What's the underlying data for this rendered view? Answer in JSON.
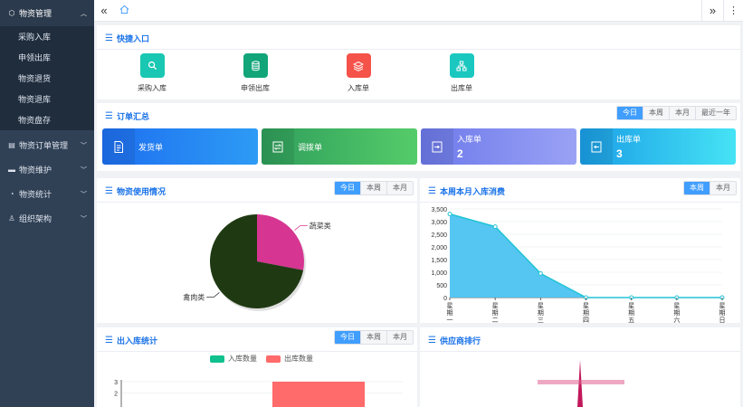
{
  "sidebar": {
    "active_group": {
      "label": "物资管理",
      "icon": "box-icon"
    },
    "subitems": [
      "采购入库",
      "申领出库",
      "物资退货",
      "物资退库",
      "物资盘存"
    ],
    "groups": [
      {
        "label": "物资订单管理",
        "icon": "clipboard-icon"
      },
      {
        "label": "物资维护",
        "icon": "monitor-icon"
      },
      {
        "label": "物资统计",
        "icon": "chart-icon"
      },
      {
        "label": "组织架构",
        "icon": "user-icon"
      }
    ]
  },
  "topbar": {
    "collapse_icon": "double-chevron-left-icon",
    "home_icon": "home-icon",
    "expand_icon": "double-chevron-right-icon",
    "menu_icon": "more-vertical-icon"
  },
  "quick": {
    "title": "快捷入口",
    "items": [
      {
        "label": "采购入库",
        "color": "#19c7b2",
        "icon": "search-icon"
      },
      {
        "label": "申领出库",
        "color": "#11a579",
        "icon": "database-icon"
      },
      {
        "label": "入库单",
        "color": "#f5524a",
        "icon": "layers-icon"
      },
      {
        "label": "出库单",
        "color": "#1bc8c0",
        "icon": "hierarchy-icon"
      }
    ]
  },
  "orders": {
    "title": "订单汇总",
    "periods": [
      "今日",
      "本周",
      "本月",
      "最近一年"
    ],
    "active_period": "今日",
    "cards": [
      {
        "label": "发货单",
        "count": "",
        "icon": "document-icon",
        "from": "#1e6ff0",
        "to": "#2d9bf5"
      },
      {
        "label": "调拨单",
        "count": "",
        "icon": "transfer-icon",
        "from": "#2f9e5b",
        "to": "#55cc6a"
      },
      {
        "label": "入库单",
        "count": "2",
        "icon": "inbox-icon",
        "from": "#6d79ea",
        "to": "#9aa2f5"
      },
      {
        "label": "出库单",
        "count": "3",
        "icon": "outbox-icon",
        "from": "#1a9ee6",
        "to": "#46e3f5"
      }
    ]
  },
  "usage": {
    "title": "物资使用情况",
    "periods": [
      "今日",
      "本周",
      "本月"
    ],
    "active_period": "今日"
  },
  "weekly": {
    "title": "本周本月入库消费",
    "periods": [
      "本周",
      "本月"
    ],
    "active_period": "本周"
  },
  "inout": {
    "title": "出入库统计",
    "periods": [
      "今日",
      "本周",
      "本月"
    ],
    "active_period": "今日"
  },
  "supplier": {
    "title": "供应商排行"
  },
  "chart_data": [
    {
      "type": "pie",
      "title": "",
      "slices": [
        {
          "name": "蔬菜类",
          "value": 28,
          "color": "#d63591"
        },
        {
          "name": "禽肉类",
          "value": 72,
          "color": "#1f3a13"
        }
      ]
    },
    {
      "type": "area",
      "title": "",
      "categories": [
        "星期一",
        "星期二",
        "星期三",
        "星期四",
        "星期五",
        "星期六",
        "星期日"
      ],
      "values": [
        3300,
        2800,
        950,
        0,
        0,
        0,
        0
      ],
      "ylim": [
        0,
        3500
      ],
      "yticks": [
        "3,500",
        "3,000",
        "2,500",
        "2,000",
        "1,500",
        "1,000",
        "500",
        "0"
      ],
      "color": "#4cc3f0",
      "line_color": "#22c4d6"
    },
    {
      "type": "bar",
      "title": "",
      "series": [
        {
          "name": "入库数量",
          "color": "#10c08d",
          "values": [
            0
          ]
        },
        {
          "name": "出库数量",
          "color": "#ff6a6a",
          "values": [
            3
          ]
        }
      ],
      "ylim": [
        0,
        3
      ],
      "yticks": [
        "3",
        "2"
      ]
    }
  ]
}
